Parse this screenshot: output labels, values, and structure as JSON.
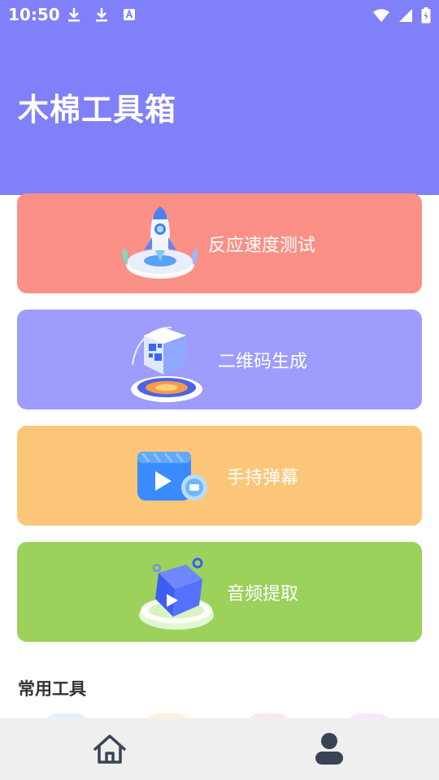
{
  "status_bar": {
    "time": "10:50",
    "left_icons": [
      "download-icon",
      "download-icon",
      "text-a-icon"
    ],
    "right_icons": [
      "wifi-icon",
      "signal-icon",
      "battery-charging-icon"
    ]
  },
  "header": {
    "title": "木棉工具箱",
    "background_color": "#8080f8"
  },
  "cards": [
    {
      "label": "反应速度测试",
      "icon": "rocket-icon",
      "color": "#fa9086"
    },
    {
      "label": "二维码生成",
      "icon": "qr-code-icon",
      "color": "#9e9cfd"
    },
    {
      "label": "手持弹幕",
      "icon": "video-play-icon",
      "color": "#fcc679"
    },
    {
      "label": "音频提取",
      "icon": "audio-cube-icon",
      "color": "#9cd15c"
    }
  ],
  "common_tools": {
    "title": "常用工具"
  },
  "bottom_nav": {
    "items": [
      {
        "icon": "home-icon"
      },
      {
        "icon": "user-icon"
      }
    ]
  }
}
